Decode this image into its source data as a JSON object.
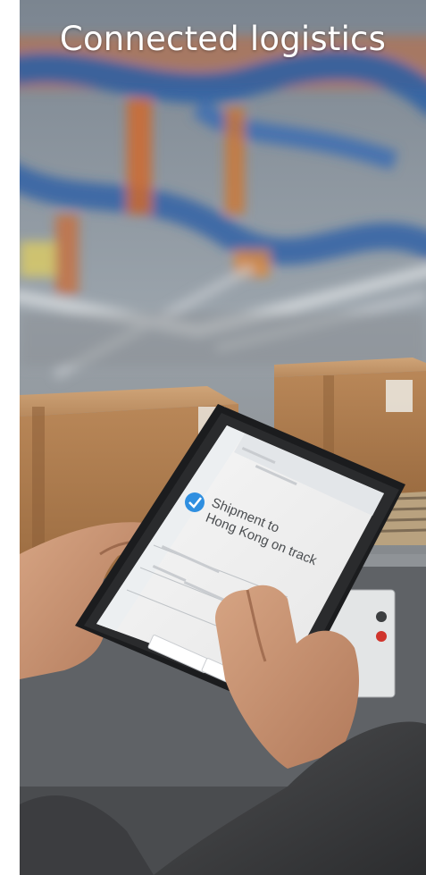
{
  "hero": {
    "title": "Connected logistics",
    "image_description": "Warehouse conveyor with cardboard boxes; a person holds a tablet"
  },
  "tablet_screen": {
    "status_title": "Shipment to Hong Kong on track",
    "status_icon": "check-circle-icon"
  },
  "colors": {
    "title_text": "#ffffff",
    "status_check_blue": "#2f8fe0",
    "conveyor_blue": "#2a5fa6",
    "box_cardboard": "#a9784b"
  }
}
